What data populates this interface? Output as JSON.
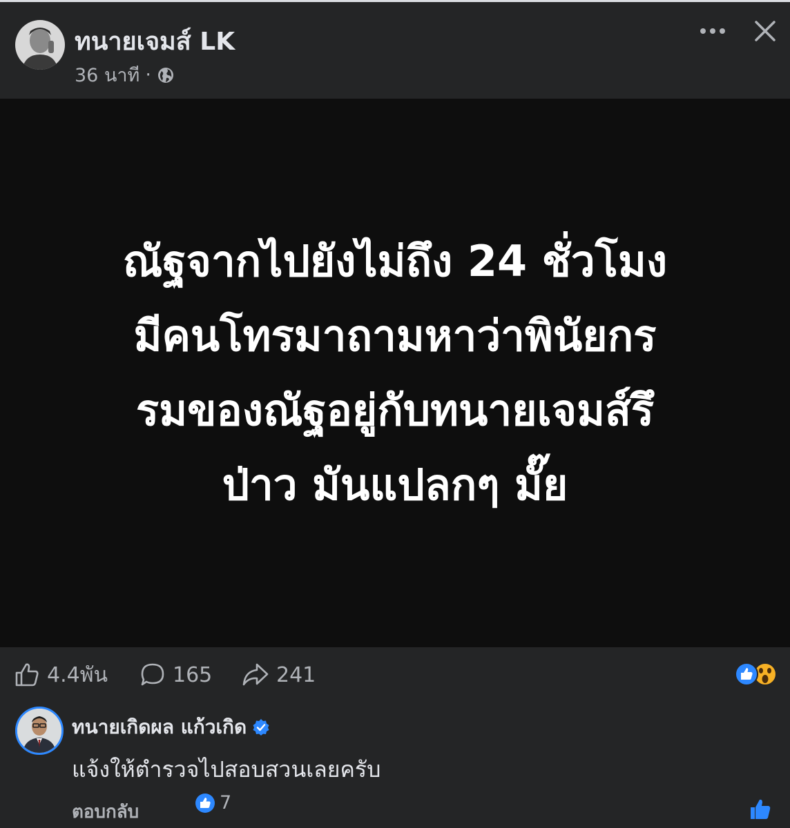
{
  "post": {
    "author": "ทนายเจมส์ LK",
    "time": "36 นาที",
    "separator": "·",
    "image_text_lines": [
      "ณัฐจากไปยังไม่ถึง 24 ชั่วโมง",
      "มีคนโทรมาถามหาว่าพินัยกร",
      "รมของณัฐอยู่กับทนายเจมส์รึ",
      "ป่าว มันแปลกๆ มั๊ย"
    ]
  },
  "stats": {
    "likes": "4.4พัน",
    "comments": "165",
    "shares": "241"
  },
  "comment": {
    "author": "ทนายเกิดผล แก้วเกิด",
    "text": "แจ้งให้ตำรวจไปสอบสวนเลยครับ",
    "reply_label": "ตอบกลับ",
    "reaction_count": "7"
  },
  "icons": {
    "audience": "globe-icon",
    "more": "more-icon",
    "close": "close-icon",
    "like": "thumbs-up-outline-icon",
    "comment": "comment-bubble-icon",
    "share": "share-arrow-icon",
    "verified": "verified-badge-icon"
  },
  "colors": {
    "background": "#242526",
    "image_background": "#0e0e0e",
    "accent": "#2d88ff",
    "text_primary": "#e4e6eb",
    "text_secondary": "#b0b3b8"
  }
}
